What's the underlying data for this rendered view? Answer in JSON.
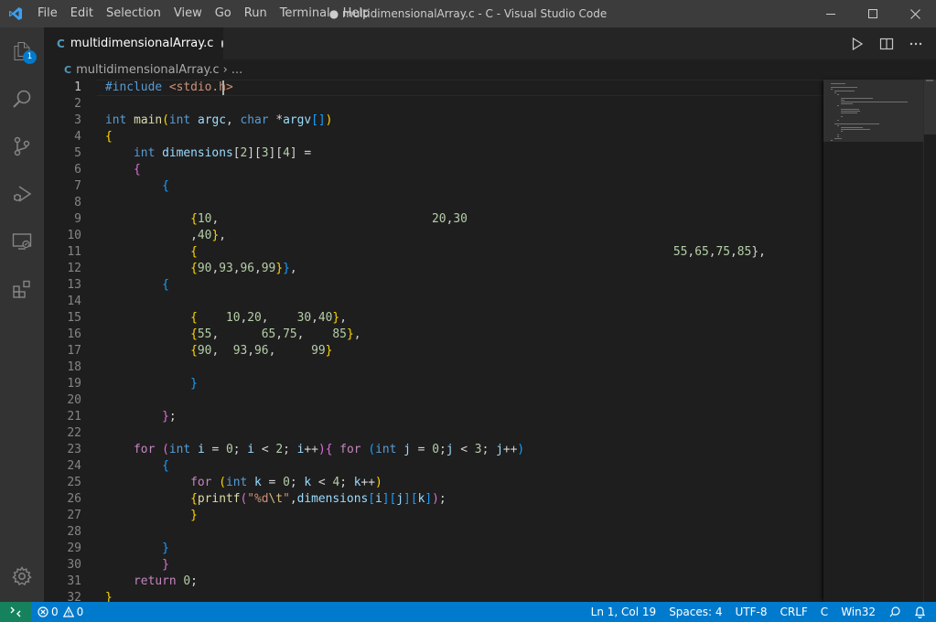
{
  "window": {
    "title": "● multidimensionalArray.c - C - Visual Studio Code"
  },
  "menu": [
    "File",
    "Edit",
    "Selection",
    "View",
    "Go",
    "Run",
    "Terminal",
    "Help"
  ],
  "activitybar": {
    "explorer_badge": "1"
  },
  "tab": {
    "icon": "C",
    "label": "multidimensionalArray.c"
  },
  "breadcrumb": {
    "icon": "C",
    "file": "multidimensionalArray.c",
    "more": "..."
  },
  "editor": {
    "line_numbers": [
      "1",
      "2",
      "3",
      "4",
      "5",
      "6",
      "7",
      "8",
      "9",
      "10",
      "11",
      "12",
      "13",
      "14",
      "15",
      "16",
      "17",
      "18",
      "19",
      "20",
      "21",
      "22",
      "23",
      "24",
      "25",
      "26",
      "27",
      "28",
      "29",
      "30",
      "31",
      "32"
    ],
    "active_line": 1,
    "cursor_column": 19
  },
  "status": {
    "errors": "0",
    "warnings": "0",
    "position": "Ln 1, Col 19",
    "spaces": "Spaces: 4",
    "encoding": "UTF-8",
    "eol": "CRLF",
    "language": "C",
    "platform": "Win32"
  },
  "colors": {
    "statusbar": "#007acc",
    "remote": "#16825d",
    "titlebar": "#3c3c3c",
    "activitybar": "#333333",
    "editor_bg": "#1e1e1e"
  }
}
